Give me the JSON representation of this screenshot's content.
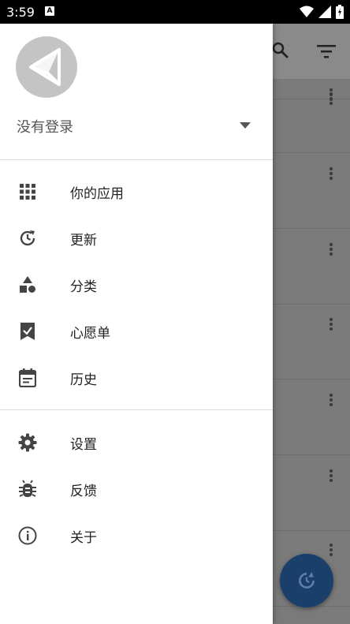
{
  "status_bar": {
    "time": "3:59",
    "notification_letter": "A"
  },
  "drawer": {
    "account": {
      "name": "没有登录"
    },
    "primary_items": [
      {
        "label": "你的应用",
        "icon": "apps-grid-icon"
      },
      {
        "label": "更新",
        "icon": "update-icon"
      },
      {
        "label": "分类",
        "icon": "category-icon"
      },
      {
        "label": "心愿单",
        "icon": "wishlist-icon"
      },
      {
        "label": "历史",
        "icon": "history-icon"
      }
    ],
    "secondary_items": [
      {
        "label": "设置",
        "icon": "settings-icon"
      },
      {
        "label": "反馈",
        "icon": "bug-icon"
      },
      {
        "label": "关于",
        "icon": "info-icon"
      }
    ]
  },
  "colors": {
    "drawer_bg": "#ffffff",
    "scrim": "#7a7a7a",
    "icon": "#444444",
    "fab": "#1b3f6b"
  }
}
